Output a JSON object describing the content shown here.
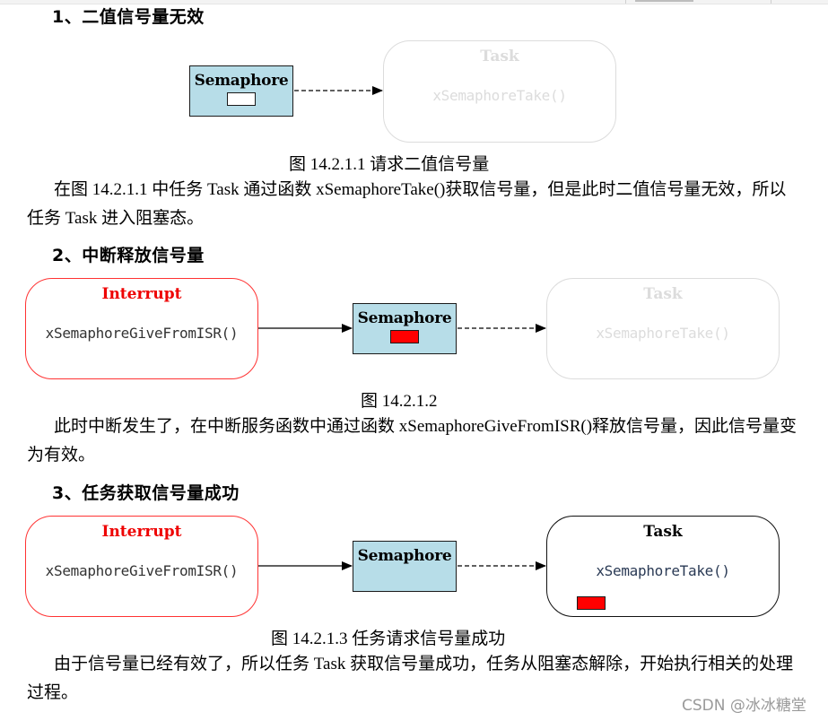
{
  "sections": [
    {
      "heading": "1、二值信号量无效",
      "diagram": {
        "semaphore": {
          "label": "Semaphore",
          "token": "empty"
        },
        "task": {
          "title": "Task",
          "func": "xSemaphoreTake()",
          "state": "faded"
        },
        "links": [
          {
            "from": "semaphore",
            "to": "task",
            "style": "dashed"
          }
        ]
      },
      "caption": "图 14.2.1.1  请求二值信号量",
      "paragraph": "在图 14.2.1.1 中任务 Task 通过函数 xSemaphoreTake()获取信号量，但是此时二值信号量无效，所以任务 Task 进入阻塞态。"
    },
    {
      "heading": "2、中断释放信号量",
      "diagram": {
        "interrupt": {
          "title": "Interrupt",
          "func": "xSemaphoreGiveFromISR()"
        },
        "semaphore": {
          "label": "Semaphore",
          "token": "full"
        },
        "task": {
          "title": "Task",
          "func": "xSemaphoreTake()",
          "state": "faded"
        },
        "links": [
          {
            "from": "interrupt",
            "to": "semaphore",
            "style": "solid"
          },
          {
            "from": "semaphore",
            "to": "task",
            "style": "dashed"
          }
        ]
      },
      "caption": "图 14.2.1.2",
      "paragraph": "此时中断发生了，在中断服务函数中通过函数 xSemaphoreGiveFromISR()释放信号量，因此信号量变为有效。"
    },
    {
      "heading": "3、任务获取信号量成功",
      "diagram": {
        "interrupt": {
          "title": "Interrupt",
          "func": "xSemaphoreGiveFromISR()"
        },
        "semaphore": {
          "label": "Semaphore",
          "token": "none"
        },
        "task": {
          "title": "Task",
          "func": "xSemaphoreTake()",
          "state": "active",
          "token": "full"
        },
        "links": [
          {
            "from": "interrupt",
            "to": "semaphore",
            "style": "solid"
          },
          {
            "from": "semaphore",
            "to": "task",
            "style": "dashed"
          }
        ]
      },
      "caption": "图 14.2.1.3  任务请求信号量成功",
      "paragraph": "由于信号量已经有效了，所以任务 Task 获取信号量成功，任务从阻塞态解除，开始执行相关的处理过程。"
    }
  ],
  "colors": {
    "semaphore_fill": "#b7dde8",
    "token_full": "#ff0000",
    "interrupt_accent": "#ee0000",
    "faded": "#dcdcdc"
  },
  "watermark": "CSDN @冰冰糖堂"
}
